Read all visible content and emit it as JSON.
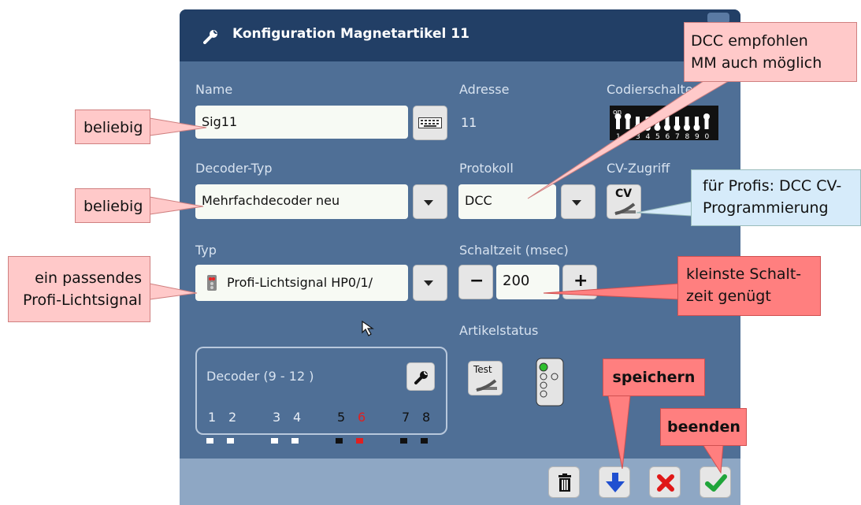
{
  "dialog": {
    "title": "Konfiguration Magnetartikel 11",
    "labels": {
      "name": "Name",
      "adresse": "Adresse",
      "codierschalter": "Codierschalter",
      "decoder_typ": "Decoder-Typ",
      "protokoll": "Protokoll",
      "cv_zugriff": "CV-Zugriff",
      "typ": "Typ",
      "schaltzeit": "Schaltzeit (msec)",
      "artikelstatus": "Artikelstatus"
    },
    "name_value": "Sig11",
    "adresse_value": "11",
    "decoder_typ_value": "Mehrfachdecoder neu",
    "protokoll_value": "DCC",
    "cv_button_label": "CV",
    "typ_value": "Profi-Lichtsignal HP0/1/",
    "schaltzeit_value": "200",
    "minus_label": "−",
    "plus_label": "+",
    "test_button_label": "Test",
    "decoder_box": {
      "title": "Decoder (9 - 12 )",
      "numbers": [
        "1",
        "2",
        "3",
        "4",
        "5",
        "6",
        "7",
        "8"
      ],
      "active_index": 5
    },
    "dip_labels": [
      "on",
      "1",
      "2",
      "3",
      "4",
      "5",
      "6",
      "7",
      "8",
      "9",
      "0"
    ]
  },
  "annotations": {
    "name_note": "beliebig",
    "decoder_note": "beliebig",
    "typ_note_line1": "ein passendes",
    "typ_note_line2": "Profi-Lichtsignal",
    "dcc_note_line1": "DCC empfohlen",
    "dcc_note_line2": "MM auch möglich",
    "cv_note_line1": "für Profis: DCC CV-",
    "cv_note_line2": "Programmierung",
    "schaltzeit_note_line1": "kleinste Schalt-",
    "schaltzeit_note_line2": "zeit genügt",
    "speichern": "speichern",
    "beenden": "beenden"
  },
  "colors": {
    "titlebar": "#223f66",
    "panel": "#4f6f96",
    "bottombar": "#8ea7c4",
    "note_pink": "#ffc9c9",
    "note_red": "#ff7f7f",
    "note_blue": "#d6ebfa",
    "active_red": "#e02020"
  }
}
